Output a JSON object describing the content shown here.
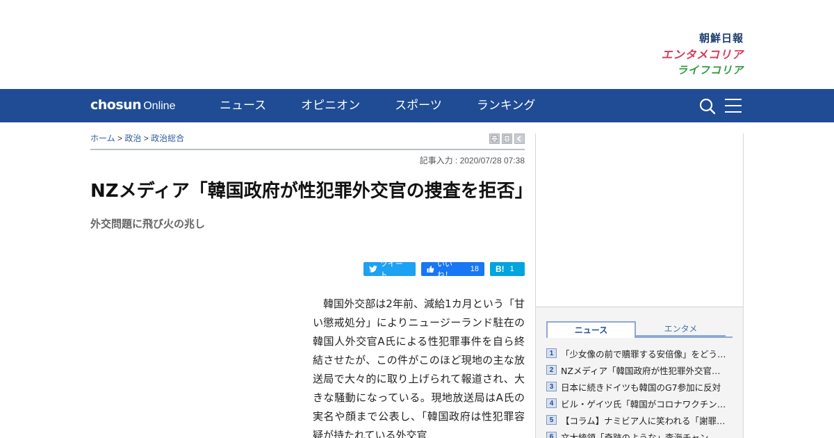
{
  "brands": [
    "朝鮮日報",
    "エンタメコリア",
    "ライフコリア"
  ],
  "nav": {
    "logo_main": "chosun",
    "logo_sub": "Online",
    "items": [
      "ニュース",
      "オピニオン",
      "スポーツ",
      "ランキング"
    ]
  },
  "breadcrumb": {
    "home": "ホーム",
    "sep": ">",
    "level1": "政治",
    "level2": "政治総合"
  },
  "article": {
    "timestamp": "記事入力 : 2020/07/28 07:38",
    "title": "NZメディア「韓国政府が性犯罪外交官の捜査を拒否」",
    "subtitle": "外交問題に飛び火の兆し",
    "body": "韓国外交部は2年前、減給1カ月という「甘い懲戒処分」によりニュージーランド駐在の韓国人外交官A氏による性犯罪事件を自ら終結させたが、この件がこのほど現地の主な放送局で大々的に取り上げられて報道され、大きな騒動になっている。現地放送局はA氏の実名や顔まで公表し、「韓国政府は性犯罪容疑が持たれている外交官"
  },
  "share": {
    "tweet": "ツイート",
    "like": "いいね！",
    "like_count": "18",
    "hatena": "B!",
    "hatena_count": "1"
  },
  "ranking": {
    "tabs": [
      "ニュース",
      "エンタメ"
    ],
    "items": [
      "「少女像の前で贖罪する安倍像」をどう見るか",
      "NZメディア「韓国政府が性犯罪外交官の捜査を拒否」",
      "日本に続きドイツも韓国のG7参加に反対",
      "ビル・ゲイツ氏「韓国がコロナワクチン供給に重要な役割」",
      "【コラム】ナミビア人に笑われる「謝罪外交」",
      "文大統領「奇跡のような」李海チャン"
    ]
  }
}
